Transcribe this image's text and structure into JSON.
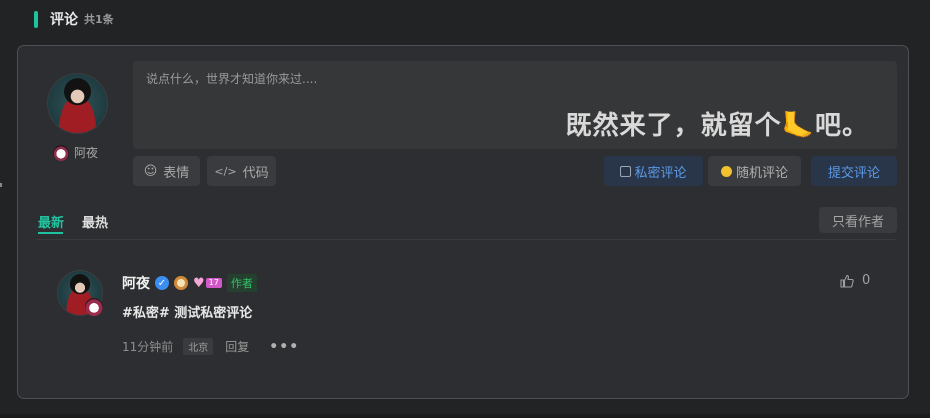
{
  "header": {
    "title": "评论",
    "count": "共1条"
  },
  "editor": {
    "username": "阿夜",
    "placeholder": "说点什么，世界才知道你来过....",
    "slogan": "既然来了，就留个🦶吧。",
    "emoji_label": "表情",
    "code_label": "代码",
    "private_label": "私密评论",
    "random_label": "随机评论",
    "submit_label": "提交评论",
    "icons": {
      "emoji": "smile-icon",
      "code": "code-icon",
      "private": "checkbox-icon",
      "random": "dice-icon"
    }
  },
  "tabs": {
    "latest": "最新",
    "hottest": "最热",
    "only_author": "只看作者"
  },
  "comments": [
    {
      "name": "阿夜",
      "level": "17",
      "role_tag": "作者",
      "content": "#私密# 测试私密评论",
      "time": "11分钟前",
      "location": "北京",
      "reply_label": "回复",
      "more": "•••",
      "likes": "0"
    }
  ],
  "colors": {
    "accent": "#20c3a0",
    "submit": "#5b9ae8",
    "verify": "#3a8ef1",
    "author_tag": "#34c06a"
  }
}
